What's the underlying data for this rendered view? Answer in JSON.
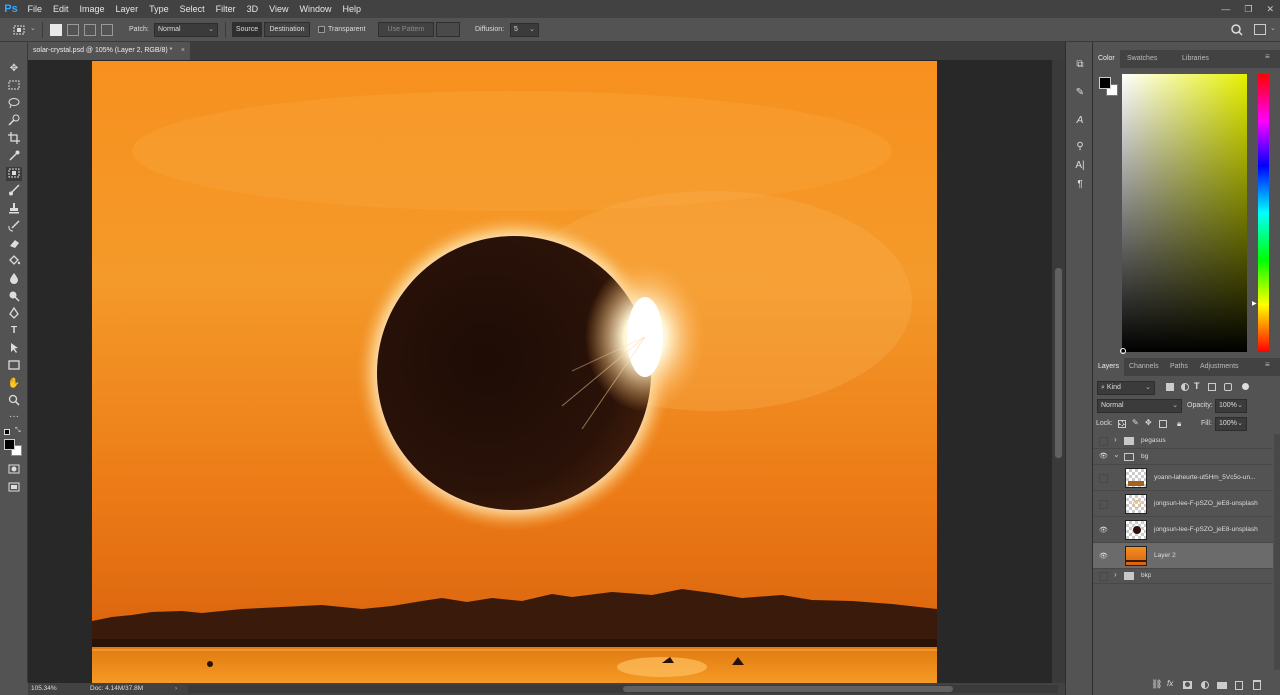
{
  "app": {
    "logo": "Ps"
  },
  "menu": [
    "File",
    "Edit",
    "Image",
    "Layer",
    "Type",
    "Select",
    "Filter",
    "3D",
    "View",
    "Window",
    "Help"
  ],
  "window_controls": {
    "minimize": "—",
    "restore": "❐",
    "close": "✕"
  },
  "options_bar": {
    "patch_label": "Patch:",
    "patch_mode": "Normal",
    "source_label": "Source",
    "destination_label": "Destination",
    "transparent_label": "Transparent",
    "use_pattern_label": "Use Pattern",
    "diffusion_label": "Diffusion:",
    "diffusion_value": "5"
  },
  "document_tab": {
    "title": "solar-crystal.psd @ 105% (Layer 2, RGB/8) *"
  },
  "status_bar": {
    "zoom": "105.34%",
    "doc_info": "Doc: 4.14M/37.8M"
  },
  "color_panel": {
    "tabs": [
      "Color",
      "Swatches",
      "Libraries"
    ],
    "foreground_color": "#000000",
    "background_color": "#ffffff",
    "hue_marker_color": "#e6f000"
  },
  "layers_panel": {
    "tabs": [
      "Layers",
      "Channels",
      "Paths",
      "Adjustments"
    ],
    "filter_kind": "Kind",
    "blend_mode": "Normal",
    "opacity_label": "Opacity:",
    "opacity_value": "100%",
    "lock_label": "Lock:",
    "fill_label": "Fill:",
    "fill_value": "100%",
    "layers": [
      {
        "name": "pegasus",
        "type": "group",
        "visible": false,
        "expanded": false
      },
      {
        "name": "bg",
        "type": "group",
        "visible": true,
        "expanded": true
      },
      {
        "name": "yoann-laheurte-ut5Hm_5Vc5o-un...",
        "type": "layer",
        "visible": false
      },
      {
        "name": "jongsun-lee-F-pSZO_jeE8-unsplash",
        "type": "layer",
        "visible": false
      },
      {
        "name": "jongsun-lee-F-pSZO_jeE8-unsplash",
        "type": "layer",
        "visible": true
      },
      {
        "name": "Layer 2",
        "type": "layer",
        "visible": true,
        "selected": true
      },
      {
        "name": "bkp",
        "type": "group",
        "visible": false,
        "expanded": false
      }
    ]
  }
}
